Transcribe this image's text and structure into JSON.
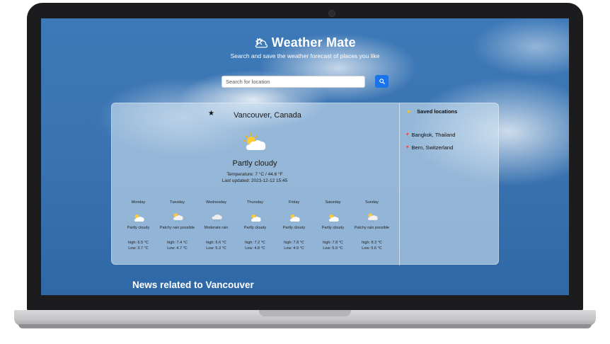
{
  "app": {
    "title": "Weather Mate",
    "subtitle": "Search and save the weather forecast of places you like",
    "title_icon": "sun-behind-cloud-icon"
  },
  "search": {
    "placeholder": "Search for location",
    "value": "",
    "button_icon": "search-icon"
  },
  "current": {
    "location": "Vancouver, Canada",
    "condition": "Partly cloudy",
    "temperature": "Temperature: 7 °C / 44.6 °F",
    "last_updated": "Last updated: 2023-12-12 15:45",
    "icon": "partly-cloudy-icon"
  },
  "forecast": [
    {
      "day": "Monday",
      "condition": "Partly cloudy",
      "high": "high: 6.5 °C",
      "low": "Low: 3.7 °C",
      "icon": "partly-cloudy-icon"
    },
    {
      "day": "Tuesday",
      "condition": "Patchy rain possible",
      "high": "high: 7.4 °C",
      "low": "Low: 4.7 °C",
      "icon": "patchy-rain-icon"
    },
    {
      "day": "Wednesday",
      "condition": "Moderate rain",
      "high": "high: 6.6 °C",
      "low": "Low: 5.3 °C",
      "icon": "rain-cloud-icon"
    },
    {
      "day": "Thursday",
      "condition": "Partly cloudy",
      "high": "high: 7.2 °C",
      "low": "Low: 4.8 °C",
      "icon": "partly-cloudy-icon"
    },
    {
      "day": "Friday",
      "condition": "Partly cloudy",
      "high": "high: 7.8 °C",
      "low": "Low: 4.9 °C",
      "icon": "partly-cloudy-icon"
    },
    {
      "day": "Saturday",
      "condition": "Partly cloudy",
      "high": "high: 7.8 °C",
      "low": "Low: 5.9 °C",
      "icon": "partly-cloudy-icon"
    },
    {
      "day": "Sunday",
      "condition": "Patchy rain possible",
      "high": "high: 8.3 °C",
      "low": "Low: 5.6 °C",
      "icon": "patchy-rain-icon"
    }
  ],
  "saved": {
    "header": "Saved locations",
    "header_icon": "star-icon",
    "items": [
      "Bangkok, Thailand",
      "Bern, Switzerland"
    ],
    "item_icon": "pin-icon"
  },
  "news": {
    "title": "News related to Vancouver"
  },
  "colors": {
    "sky": "#3a74b1",
    "accent": "#1a73e8",
    "panel": "#cde0f0",
    "star": "#f5c518",
    "pin": "#e0463a"
  }
}
